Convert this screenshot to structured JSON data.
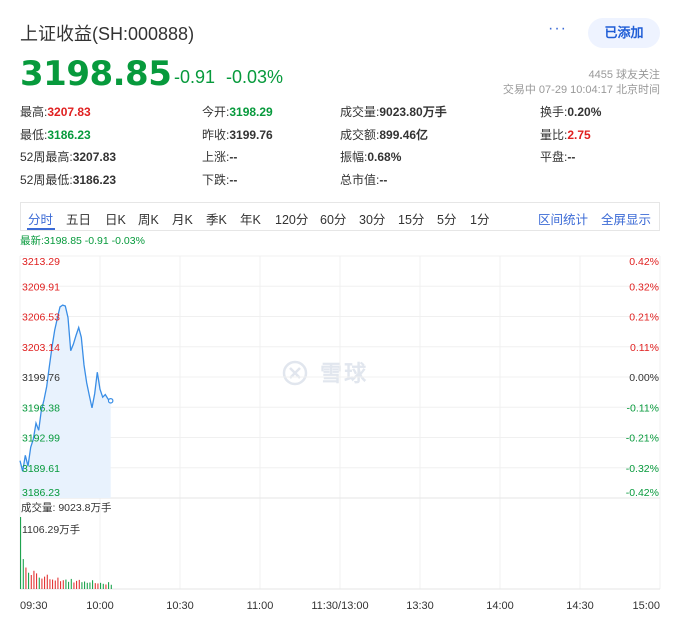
{
  "header": {
    "title": "上证收益(SH:000888)",
    "more_label": "···",
    "add_button_label": "已添加"
  },
  "quote": {
    "price": "3198.85",
    "change": "-0.91",
    "change_percent": "-0.03%",
    "followers": "4455 球友关注",
    "trade_status": "交易中 07-29 10:04:17 北京时间"
  },
  "stats": {
    "rows": [
      [
        {
          "label": "最高:",
          "value": "3207.83",
          "tone": "up"
        },
        {
          "label": "今开:",
          "value": "3198.29",
          "tone": "dn"
        },
        {
          "label": "成交量:",
          "value": "9023.80万手",
          "tone": ""
        },
        {
          "label": "换手:",
          "value": "0.20%",
          "tone": ""
        }
      ],
      [
        {
          "label": "最低:",
          "value": "3186.23",
          "tone": "dn"
        },
        {
          "label": "昨收:",
          "value": "3199.76",
          "tone": ""
        },
        {
          "label": "成交额:",
          "value": "899.46亿",
          "tone": ""
        },
        {
          "label": "量比:",
          "value": "2.75",
          "tone": "up"
        }
      ],
      [
        {
          "label": "52周最高:",
          "value": "3207.83",
          "tone": ""
        },
        {
          "label": "上涨:",
          "value": "--",
          "tone": ""
        },
        {
          "label": "振幅:",
          "value": "0.68%",
          "tone": ""
        },
        {
          "label": "平盘:",
          "value": "--",
          "tone": ""
        }
      ],
      [
        {
          "label": "52周最低:",
          "value": "3186.23",
          "tone": ""
        },
        {
          "label": "下跌:",
          "value": "--",
          "tone": ""
        },
        {
          "label": "总市值:",
          "value": "--",
          "tone": ""
        },
        {
          "label": "",
          "value": "",
          "tone": ""
        }
      ]
    ]
  },
  "tabs": [
    "分时",
    "五日",
    "日K",
    "周K",
    "月K",
    "季K",
    "年K",
    "120分",
    "60分",
    "30分",
    "15分",
    "5分",
    "1分"
  ],
  "active_tab": "分时",
  "tab_links": [
    "区间统计",
    "全屏显示"
  ],
  "latest_line": "最新:3198.85 -0.91 -0.03%",
  "watermark": "雪球",
  "colors": {
    "up": "#e02020",
    "down": "#079a3c",
    "accent": "#3c6bd6",
    "line": "#3a8ee6",
    "area": "#e8f2fd"
  },
  "chart_data": {
    "type": "line",
    "price_axis_left": [
      "3213.29",
      "3209.91",
      "3206.53",
      "3203.14",
      "3199.76",
      "3196.38",
      "3192.99",
      "3189.61",
      "3186.23"
    ],
    "pct_axis_right": [
      "0.42%",
      "0.32%",
      "0.21%",
      "0.11%",
      "0.00%",
      "-0.11%",
      "-0.21%",
      "-0.32%",
      "-0.42%"
    ],
    "ylim": [
      3186.23,
      3213.29
    ],
    "prev_close": 3199.76,
    "time_labels": [
      "09:30",
      "10:00",
      "10:30",
      "11:00",
      "11:30/13:00",
      "13:30",
      "14:00",
      "14:30",
      "15:00"
    ],
    "total_minutes": 240,
    "price_series": {
      "minutes": [
        0,
        1,
        2,
        3,
        4,
        5,
        6,
        7,
        8,
        9,
        10,
        11,
        12,
        13,
        14,
        15,
        16,
        17,
        18,
        19,
        20,
        21,
        22,
        23,
        24,
        25,
        26,
        27,
        28,
        29,
        30,
        31,
        32,
        33,
        34
      ],
      "values": [
        3190.4,
        3189.2,
        3191.0,
        3189.8,
        3191.9,
        3192.8,
        3194.6,
        3193.8,
        3196.0,
        3197.2,
        3198.7,
        3200.9,
        3203.1,
        3205.0,
        3206.3,
        3207.6,
        3207.8,
        3207.7,
        3206.4,
        3202.7,
        3203.4,
        3204.4,
        3205.3,
        3204.2,
        3201.1,
        3199.1,
        3197.7,
        3196.3,
        3197.9,
        3200.3,
        3198.4,
        3197.5,
        3197.8,
        3197.3,
        3197.1
      ]
    },
    "volume_label": "成交量: 9023.8万手",
    "volume_ylabel": "1106.29万手",
    "volume_max": 1106.29,
    "volume_series": [
      1106,
      460,
      330,
      250,
      215,
      280,
      240,
      175,
      160,
      190,
      220,
      150,
      145,
      130,
      175,
      120,
      135,
      145,
      110,
      155,
      100,
      125,
      140,
      105,
      115,
      95,
      100,
      135,
      90,
      85,
      95,
      80,
      70,
      105,
      65
    ]
  }
}
